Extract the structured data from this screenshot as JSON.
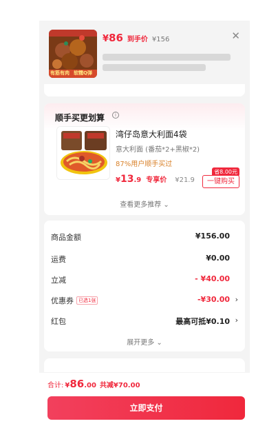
{
  "product": {
    "price_symbol": "¥",
    "price": "86",
    "price_tag": "到手价",
    "original_price": "¥156",
    "image_tags": [
      "有筋有肉",
      "软糯Q弹"
    ],
    "close_icon": "close-icon"
  },
  "bundle": {
    "title": "顺手买更划算",
    "info_icon": "info-icon",
    "item": {
      "name": "湾仔岛意大利面4袋",
      "spec": "意大利面 (番茄*2+黑椒*2)",
      "bought": "87%用户顺手买过",
      "price_symbol": "¥",
      "price_int": "13",
      "price_dec": ".9",
      "price_tag": "专享价",
      "original_price": "¥21.9",
      "save_badge": "省8.00元",
      "buy_label": "一键购买"
    },
    "see_more": "查看更多推荐"
  },
  "summary": {
    "rows": [
      {
        "label": "商品金额",
        "value": "¥156.00"
      },
      {
        "label": "运费",
        "value": "¥0.00"
      },
      {
        "label": "立减",
        "value": "- ¥40.00"
      },
      {
        "label": "优惠券",
        "chip": "已选1张",
        "value": "-¥30.00"
      },
      {
        "label": "红包",
        "value": "最高可抵¥0.10"
      }
    ],
    "expand": "展开更多"
  },
  "footer": {
    "total_label": "合计:",
    "total_symbol": "¥",
    "total_int": "86",
    "total_dec": ".00",
    "total_saving": "共减¥70.00",
    "pay_label": "立即支付"
  },
  "colors": {
    "accent": "#f0283c",
    "bought_orange": "#d9822b",
    "background": "#f4f4f4"
  }
}
